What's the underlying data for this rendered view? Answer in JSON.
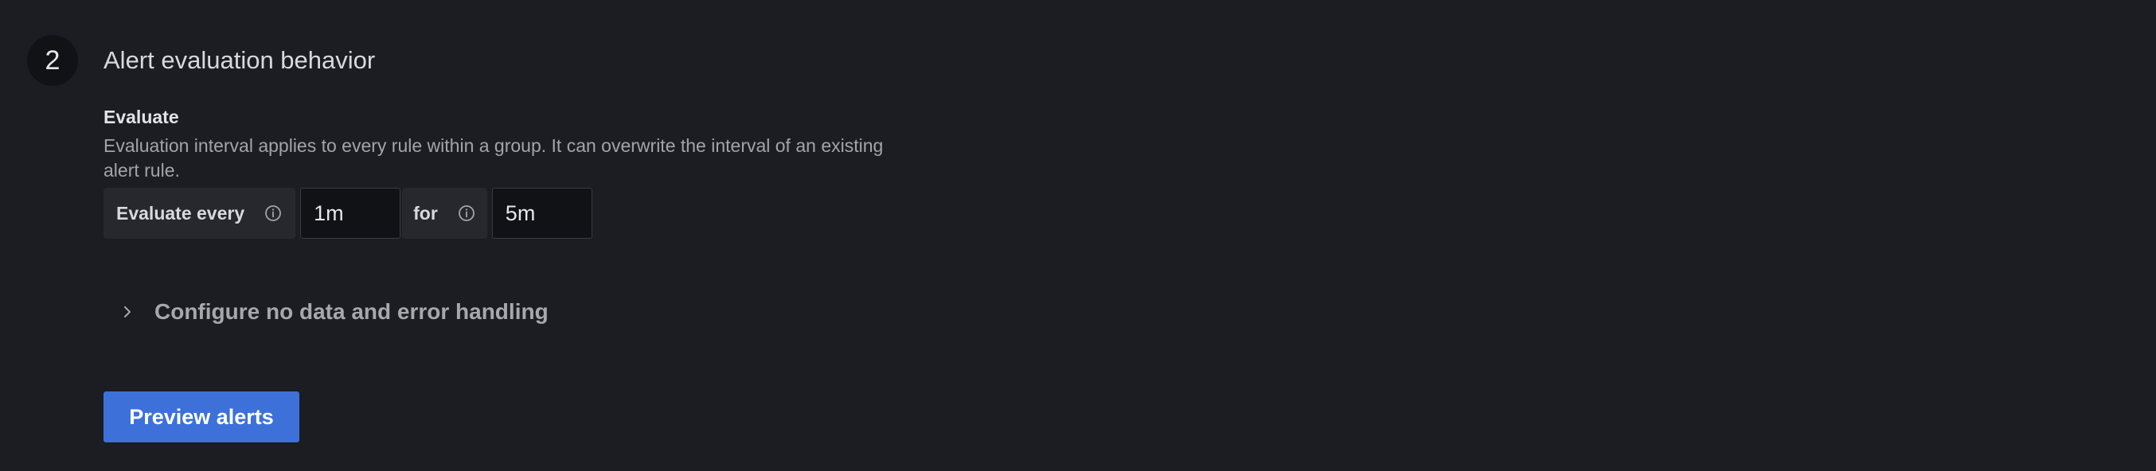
{
  "section": {
    "step_number": "2",
    "title": "Alert evaluation behavior"
  },
  "evaluate": {
    "label": "Evaluate",
    "description": "Evaluation interval applies to every rule within a group. It can overwrite the interval of an existing alert rule.",
    "every_label": "Evaluate every",
    "every_value": "1m",
    "for_label": "for",
    "for_value": "5m",
    "info_icon": "info-circle-icon"
  },
  "config": {
    "label": "Configure no data and error handling",
    "expanded": false,
    "icon": "chevron-right-icon"
  },
  "actions": {
    "preview_label": "Preview alerts"
  },
  "colors": {
    "background": "#1c1d22",
    "primary_button": "#3d71d9",
    "muted_text": "#a2a4ab"
  }
}
